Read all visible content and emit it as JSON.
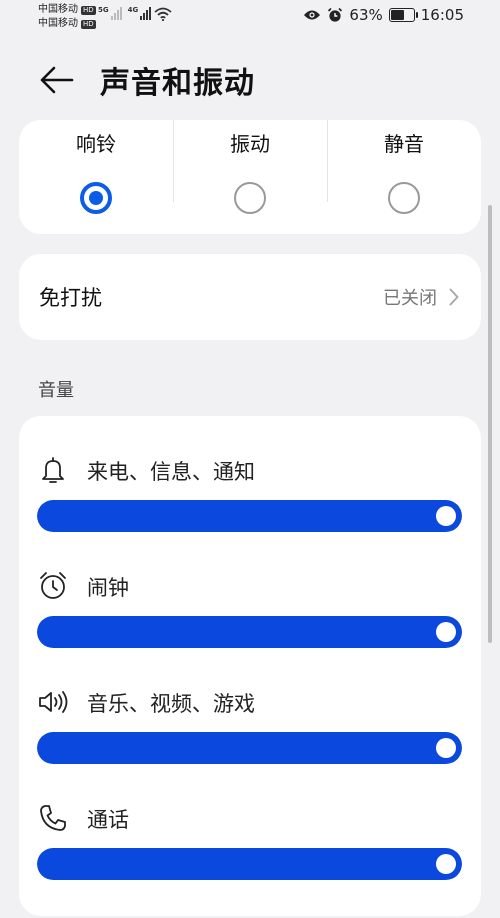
{
  "status_bar": {
    "carrier1": "中国移动",
    "carrier2": "中国移动",
    "hd": "HD",
    "net1": "5G",
    "net2": "4G",
    "battery_percent": "63%",
    "battery_level": 0.63,
    "time": "16:05"
  },
  "header": {
    "title": "声音和振动"
  },
  "modes": [
    {
      "label": "响铃",
      "selected": true
    },
    {
      "label": "振动",
      "selected": false
    },
    {
      "label": "静音",
      "selected": false
    }
  ],
  "dnd": {
    "label": "免打扰",
    "value": "已关闭"
  },
  "volume": {
    "section_title": "音量",
    "items": [
      {
        "label": "来电、信息、通知",
        "icon": "bell-icon",
        "level": 1.0
      },
      {
        "label": "闹钟",
        "icon": "alarm-clock-icon",
        "level": 1.0
      },
      {
        "label": "音乐、视频、游戏",
        "icon": "speaker-icon",
        "level": 1.0
      },
      {
        "label": "通话",
        "icon": "phone-icon",
        "level": 1.0
      }
    ]
  },
  "colors": {
    "accent": "#0b5ce6",
    "slider": "#0b49de",
    "background": "#f1f1f3"
  }
}
